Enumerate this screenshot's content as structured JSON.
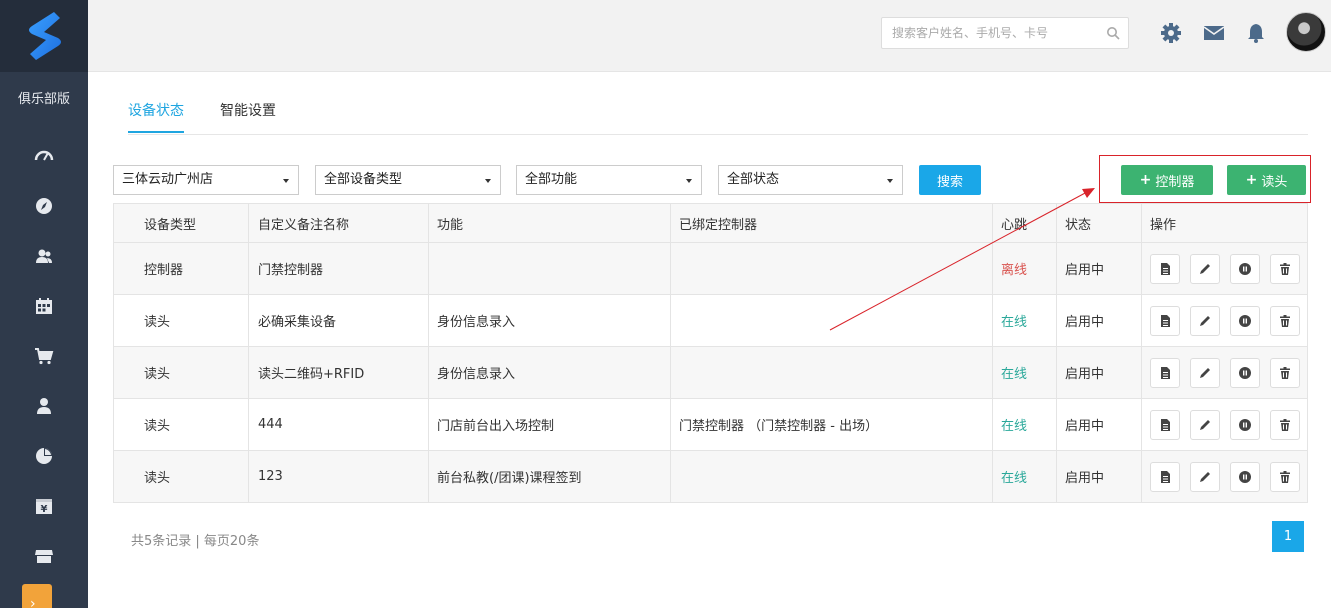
{
  "sidebar": {
    "club_label": "俱乐部版",
    "items": [
      {
        "icon": "dashboard-icon"
      },
      {
        "icon": "compass-icon"
      },
      {
        "icon": "members-icon"
      },
      {
        "icon": "calendar-icon"
      },
      {
        "icon": "cart-icon"
      },
      {
        "icon": "user-icon"
      },
      {
        "icon": "pie-chart-icon"
      },
      {
        "icon": "finance-icon"
      },
      {
        "icon": "store-icon"
      }
    ]
  },
  "header": {
    "search_placeholder": "搜索客户姓名、手机号、卡号"
  },
  "tabs": [
    {
      "label": "设备状态",
      "active": true
    },
    {
      "label": "智能设置",
      "active": false
    }
  ],
  "filters": {
    "store": "三体云动广州店",
    "device_type": "全部设备类型",
    "function": "全部功能",
    "status": "全部状态",
    "search_label": "搜索"
  },
  "actions": {
    "add_controller": "控制器",
    "add_reader": "读头"
  },
  "table": {
    "headers": [
      "设备类型",
      "自定义备注名称",
      "功能",
      "已绑定控制器",
      "心跳",
      "状态",
      "操作"
    ],
    "rows": [
      {
        "type": "控制器",
        "name": "门禁控制器",
        "function": "",
        "controller": "",
        "heartbeat": "离线",
        "status": "启用中"
      },
      {
        "type": "读头",
        "name": "必确采集设备",
        "function": "身份信息录入",
        "controller": "",
        "heartbeat": "在线",
        "status": "启用中"
      },
      {
        "type": "读头",
        "name": "读头二维码+RFID",
        "function": "身份信息录入",
        "controller": "",
        "heartbeat": "在线",
        "status": "启用中"
      },
      {
        "type": "读头",
        "name": "444",
        "function": "门店前台出入场控制",
        "controller": "门禁控制器 （门禁控制器 - 出场）",
        "heartbeat": "在线",
        "status": "启用中"
      },
      {
        "type": "读头",
        "name": "123",
        "function": "前台私教(/团课)课程签到",
        "controller": "",
        "heartbeat": "在线",
        "status": "启用中"
      }
    ]
  },
  "pagination": {
    "summary": "共5条记录 | 每页20条",
    "current_page": "1"
  },
  "colors": {
    "sidebar": "#2f3a4b",
    "accent": "#1aa7e8",
    "green": "#3cb371",
    "offline": "#d9534f",
    "online": "#2aa89a",
    "annotation": "#d9232a"
  }
}
